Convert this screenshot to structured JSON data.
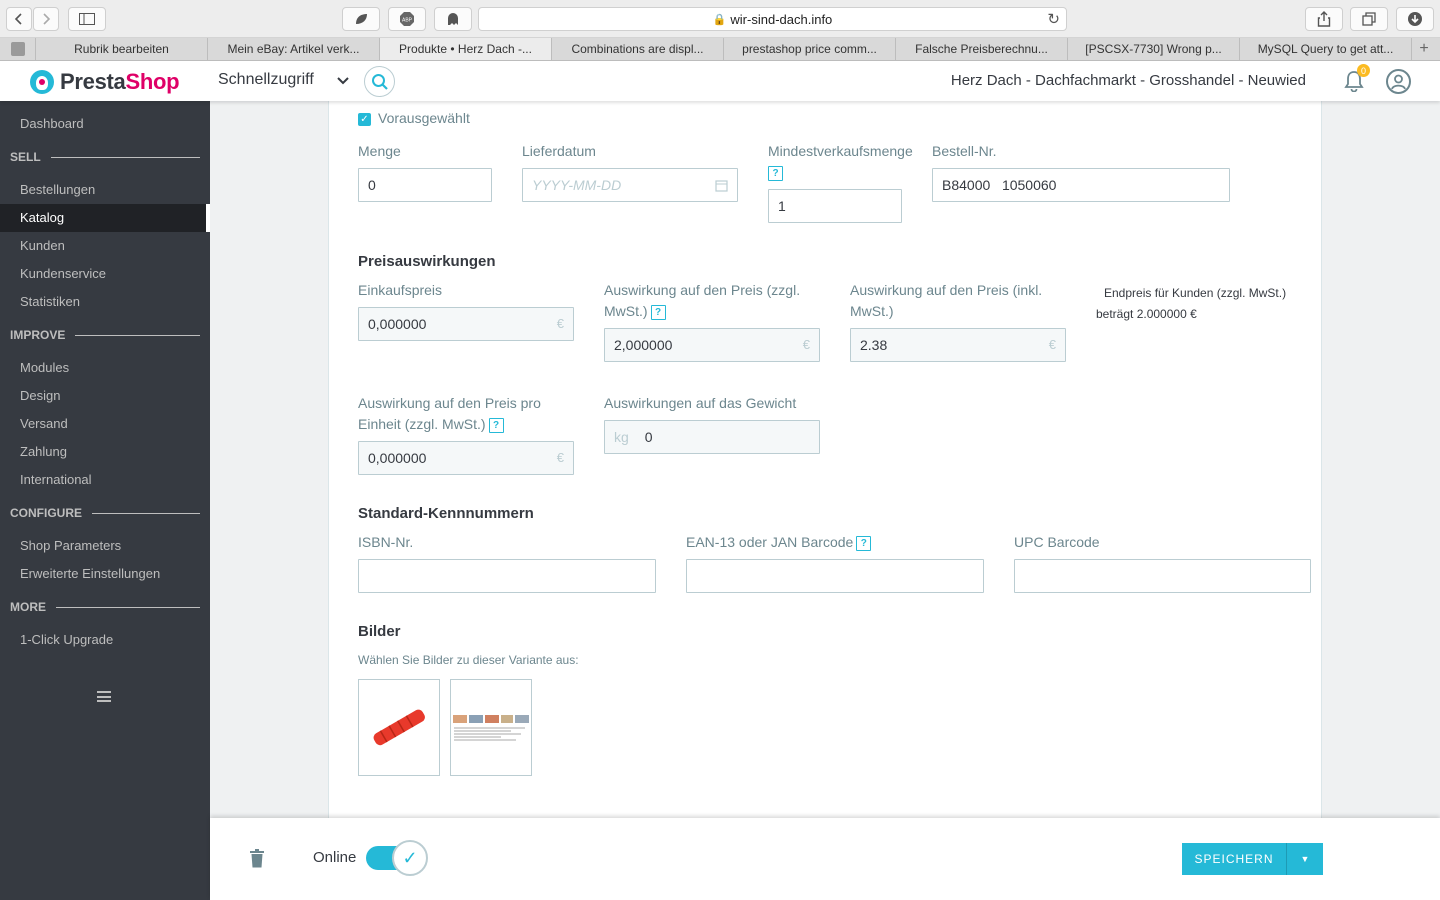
{
  "browser": {
    "url": "wir-sind-dach.info",
    "tabs": [
      {
        "label": "Rubrik bearbeiten",
        "active": false
      },
      {
        "label": "Mein eBay: Artikel verk...",
        "active": false
      },
      {
        "label": "Produkte • Herz Dach -...",
        "active": true
      },
      {
        "label": "Combinations are displ...",
        "active": false
      },
      {
        "label": "prestashop price comm...",
        "active": false
      },
      {
        "label": "Falsche Preisberechnu...",
        "active": false
      },
      {
        "label": "[PSCSX-7730] Wrong p...",
        "active": false
      },
      {
        "label": "MySQL Query to get att...",
        "active": false
      }
    ]
  },
  "header": {
    "logo_presta": "Presta",
    "logo_shop": "Shop",
    "quick_access": "Schnellzugriff",
    "shop_name": "Herz Dach - Dachfachmarkt - Grosshandel - Neuwied",
    "notifications_count": "0"
  },
  "sidebar": {
    "dashboard": "Dashboard",
    "sell": "SELL",
    "sell_items": [
      "Bestellungen",
      "Katalog",
      "Kunden",
      "Kundenservice",
      "Statistiken"
    ],
    "improve": "IMPROVE",
    "improve_items": [
      "Modules",
      "Design",
      "Versand",
      "Zahlung",
      "International"
    ],
    "configure": "CONFIGURE",
    "configure_items": [
      "Shop Parameters",
      "Erweiterte Einstellungen"
    ],
    "more": "MORE",
    "more_items": [
      "1-Click Upgrade"
    ],
    "active": "Katalog"
  },
  "form": {
    "preselected_label": "Vorausgewählt",
    "preselected_checked": true,
    "quantity": {
      "label": "Menge",
      "value": "0"
    },
    "availability_date": {
      "label": "Lieferdatum",
      "placeholder": "YYYY-MM-DD"
    },
    "min_quantity": {
      "label": "Mindestverkaufsmenge",
      "value": "1"
    },
    "reference": {
      "label": "Bestell-Nr.",
      "value": "B84000   1050060"
    },
    "price_section": "Preisauswirkungen",
    "wholesale_price": {
      "label": "Einkaufspreis",
      "value": "0,000000",
      "unit": "€"
    },
    "impact_price_excl": {
      "label": "Auswirkung auf den Preis (zzgl. MwSt.)",
      "value": "2,000000",
      "unit": "€"
    },
    "impact_price_incl": {
      "label": "Auswirkung auf den Preis (inkl. MwSt.)",
      "value": "2.38",
      "unit": "€"
    },
    "final_price_line1": "Endpreis für Kunden (zzgl. MwSt.)",
    "final_price_line2": "beträgt 2.000000 €",
    "unit_price_impact": {
      "label": "Auswirkung auf den Preis pro Einheit (zzgl. MwSt.)",
      "value": "0,000000",
      "unit": "€"
    },
    "weight_impact": {
      "label": "Auswirkungen auf das Gewicht",
      "value": "0",
      "unit": "kg"
    },
    "identifiers_section": "Standard-Kennnummern",
    "isbn": {
      "label": "ISBN-Nr.",
      "value": ""
    },
    "ean13": {
      "label": "EAN-13 oder JAN Barcode",
      "value": ""
    },
    "upc": {
      "label": "UPC Barcode",
      "value": ""
    },
    "images_section": "Bilder",
    "images_hint": "Wählen Sie Bilder zu dieser Variante aus:",
    "help_glyph": "?"
  },
  "footer": {
    "online_label": "Online",
    "online_enabled": true,
    "save_label": "SPEICHERN"
  },
  "colors": {
    "accent": "#25b9d7",
    "brand_pink": "#df0067",
    "sidebar_bg": "#363a41",
    "badge": "#fbbb22"
  }
}
